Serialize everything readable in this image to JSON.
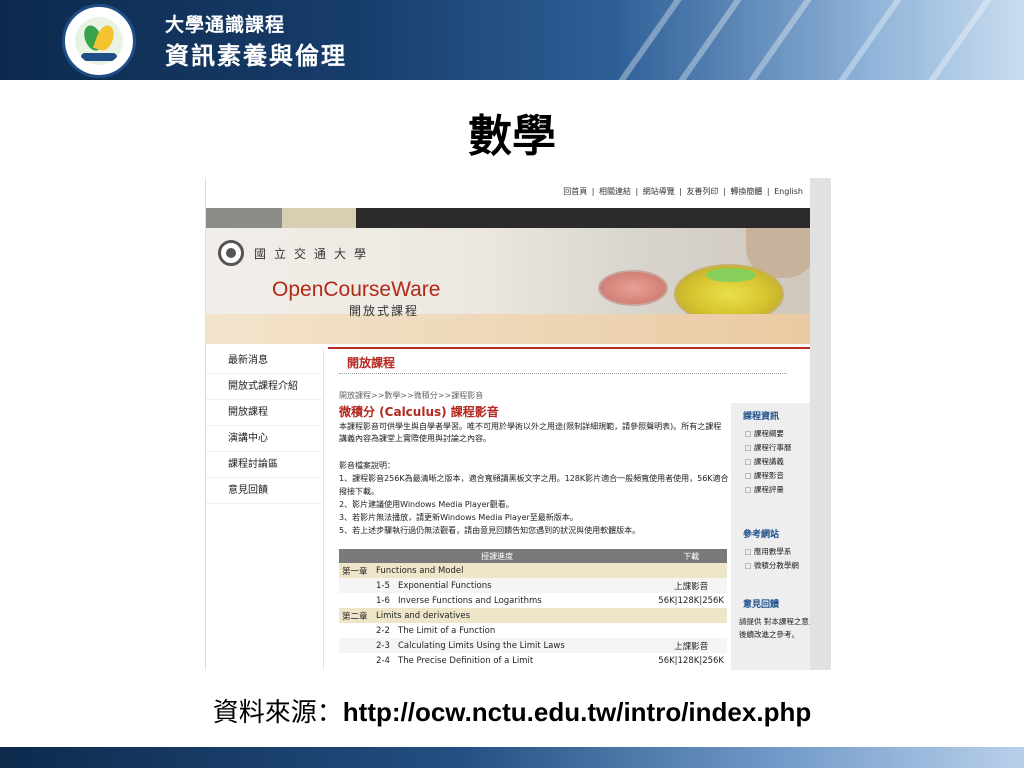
{
  "slide": {
    "banner_line1": "大學通識課程",
    "banner_line2": "資訊素養與倫理",
    "title": "數學",
    "source_label": "資料來源：",
    "source_url": "http://ocw.nctu.edu.tw/intro/index.php"
  },
  "ocw": {
    "top_links": [
      "回首頁",
      "相關連結",
      "網站導覽",
      "友善列印",
      "轉換簡體",
      "English"
    ],
    "university_name": "國立交通大學",
    "logo_text": "OpenCourseWare",
    "logo_sub": "開放式課程",
    "nav_items": [
      "最新消息",
      "開放式課程介紹",
      "開放課程",
      "演講中心",
      "課程討論區",
      "意見回饋"
    ],
    "section_title": "開放課程",
    "breadcrumb": "開放課程>>數學>>微積分>>課程影音",
    "course_title": "微積分 (Calculus) 課程影音",
    "description": "本課程影音可供學生與自學者學習。唯不可用於學術以外之用途(限制詳細規範，請參照聲明表)。所有之課程講義內容為課堂上實際使用與討論之內容。",
    "notes": [
      "影音檔案說明：",
      "1、課程影音256K為最清晰之版本，適合寬頻讀黑板文字之用。128K影片適合一般頻寬使用者使用，56K適合撥接下載。",
      "2、影片建議使用Windows Media Player觀看。",
      "3、若影片無法播放，請更新Windows Media Player至最新版本。",
      "5、若上述步驟執行過仍無法觀看，請由意見回饋告知您遇到的狀況與使用軟體版本。"
    ],
    "table": {
      "header_progress": "授課進度",
      "header_download": "下載",
      "chapter1": {
        "num": "第一章",
        "title": "Functions and Model"
      },
      "ch1_rows": [
        {
          "num": "1-5",
          "title": "Exponential Functions"
        },
        {
          "num": "1-6",
          "title": "Inverse Functions and Logarithms"
        }
      ],
      "ch1_dl_label": "上課影音",
      "ch1_dl_links": "56K|128K|256K",
      "chapter2": {
        "num": "第二章",
        "title": "Limits and derivatives"
      },
      "ch2_rows": [
        {
          "num": "2-2",
          "title": "The Limit of a Function"
        },
        {
          "num": "2-3",
          "title": "Calculating Limits Using the Limit Laws"
        },
        {
          "num": "2-4",
          "title": "The Precise Definition of a Limit"
        }
      ],
      "ch2_dl_label": "上課影音",
      "ch2_dl_links": "56K|128K|256K"
    },
    "sidebar": {
      "course_info_heading": "課程資訊",
      "course_info_items": [
        "課程綱要",
        "課程行事曆",
        "課程講義",
        "課程影音",
        "課程評量"
      ],
      "ref_heading": "參考網站",
      "ref_items": [
        "應用數學系",
        "微積分教學網"
      ],
      "feedback_heading": "意見回饋",
      "feedback_text": "請提供 對本課程之意見作為後續改進之參考。"
    }
  }
}
